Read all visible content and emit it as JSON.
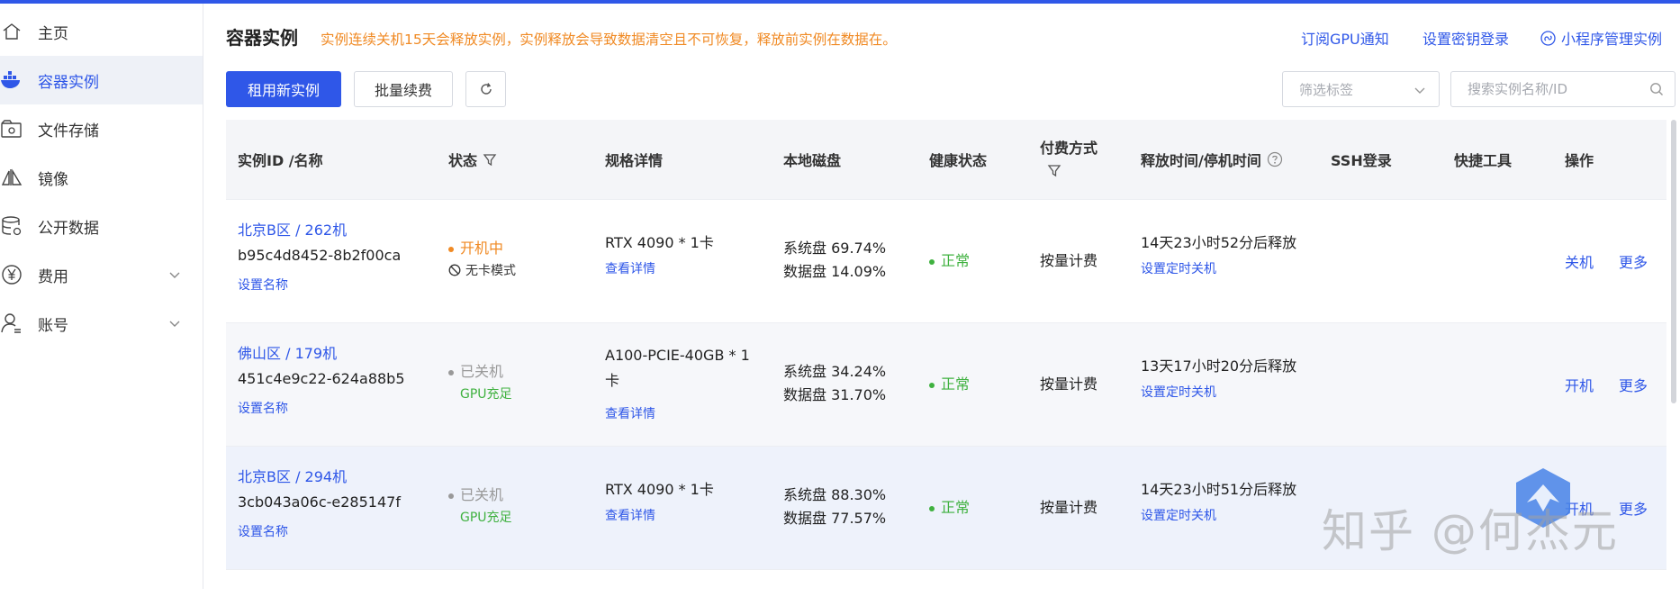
{
  "sidebar": {
    "items": [
      {
        "label": "主页",
        "icon": "home-icon"
      },
      {
        "label": "容器实例",
        "icon": "docker-icon",
        "active": true
      },
      {
        "label": "文件存储",
        "icon": "storage-icon"
      },
      {
        "label": "镜像",
        "icon": "image-icon"
      },
      {
        "label": "公开数据",
        "icon": "database-icon"
      },
      {
        "label": "费用",
        "icon": "yen-icon",
        "expandable": true
      },
      {
        "label": "账号",
        "icon": "user-icon",
        "expandable": true
      }
    ]
  },
  "header": {
    "title": "容器实例",
    "notice": "实例连续关机15天会释放实例，实例释放会导致数据清空且不可恢复，释放前实例在数据在。",
    "links": {
      "gpu_notify": "订阅GPU通知",
      "ssh_key": "设置密钥登录",
      "miniprogram": "小程序管理实例"
    }
  },
  "toolbar": {
    "rent_button": "租用新实例",
    "batch_renew_button": "批量续费",
    "filter_placeholder": "筛选标签",
    "search_placeholder": "搜索实例名称/ID"
  },
  "table": {
    "headers": {
      "id": "实例ID /名称",
      "status": "状态",
      "spec": "规格详情",
      "disk": "本地磁盘",
      "health": "健康状态",
      "billing": "付费方式",
      "release": "释放时间/停机时间",
      "ssh": "SSH登录",
      "tools": "快捷工具",
      "actions": "操作"
    },
    "rows": [
      {
        "region": "北京B区 / 262机",
        "id": "b95c4d8452-8b2f00ca",
        "set_name": "设置名称",
        "status": "开机中",
        "status_type": "running",
        "sub_status": "无卡模式",
        "spec": "RTX 4090 * 1卡",
        "spec_detail": "查看详情",
        "sys_disk": "系统盘 69.74%",
        "data_disk": "数据盘 14.09%",
        "health": "正常",
        "billing": "按量计费",
        "release": "14天23小时52分后释放",
        "timer": "设置定时关机",
        "action": "关机",
        "more": "更多"
      },
      {
        "region": "佛山区 / 179机",
        "id": "451c4e9c22-624a88b5",
        "set_name": "设置名称",
        "status": "已关机",
        "status_type": "stopped",
        "sub_status": "GPU充足",
        "spec": "A100-PCIE-40GB * 1卡",
        "spec_detail": "查看详情",
        "sys_disk": "系统盘 34.24%",
        "data_disk": "数据盘 31.70%",
        "health": "正常",
        "billing": "按量计费",
        "release": "13天17小时20分后释放",
        "timer": "设置定时关机",
        "action": "开机",
        "more": "更多"
      },
      {
        "region": "北京B区 / 294机",
        "id": "3cb043a06c-e285147f",
        "set_name": "设置名称",
        "status": "已关机",
        "status_type": "stopped",
        "sub_status": "GPU充足",
        "spec": "RTX 4090 * 1卡",
        "spec_detail": "查看详情",
        "sys_disk": "系统盘 88.30%",
        "data_disk": "数据盘 77.57%",
        "health": "正常",
        "billing": "按量计费",
        "release": "14天23小时51分后释放",
        "timer": "设置定时关机",
        "action": "开机",
        "more": "更多"
      }
    ]
  },
  "watermark": "知乎 @何杰元",
  "colors": {
    "accent": "#2f57e8",
    "warning": "#f08a24",
    "success": "#3fb13f",
    "muted": "#999999"
  }
}
